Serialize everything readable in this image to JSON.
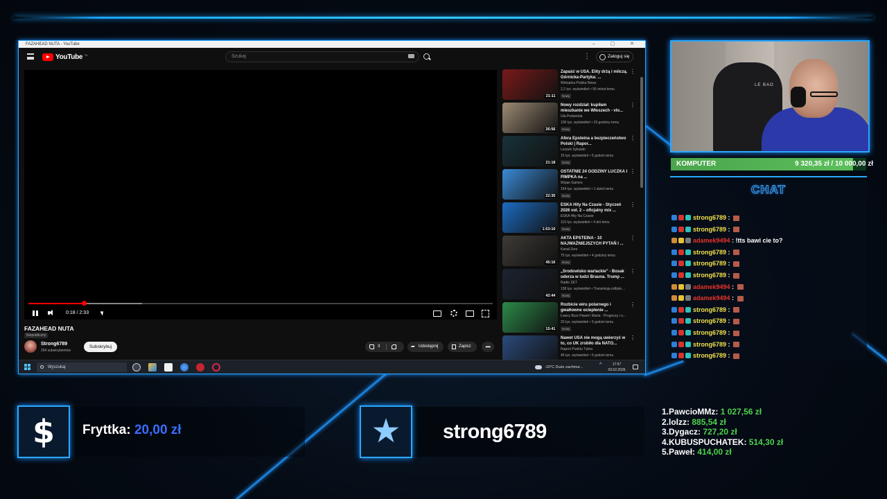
{
  "browser": {
    "window_title": "FAZAHEAD NUTA - YouTube",
    "window_controls": "– ▢ ✕"
  },
  "youtube": {
    "logo_text": "YouTube",
    "logo_sup": "PL",
    "search_placeholder": "Szukaj",
    "login_label": "Zaloguj się",
    "player": {
      "time": "0:18 / 2:33",
      "progress_fraction": 0.12,
      "buffer_fraction": 0.245
    },
    "video": {
      "title": "FAZAHEAD NUTA",
      "visibility": "Niepubliczny",
      "channel": "Strong6789",
      "subscribers": "254 subskrybentów",
      "subscribe_label": "Subskrybuj",
      "likes": "3",
      "share_label": "Udostępnij",
      "save_label": "Zapisz",
      "more_label": "•••"
    },
    "recommendations": [
      {
        "title": "Zapaść w USA. Elity drżą i milczą. Górnicka-Partyka: ...",
        "channel": "Wirtualna Polska News",
        "meta": "2,2 tys. wyświetleń • 56 minut temu",
        "badge": "Nowy",
        "duration": "21:11",
        "color": "#7a1a1a"
      },
      {
        "title": "Nowy rozdział: kupiłam mieszkanie we Włoszech - vlo...",
        "channel": "Ula Pedantula",
        "meta": "106 tys. wyświetleń • 23 godziny temu",
        "badge": "Nowy",
        "duration": "26:56",
        "color": "#9c8a74"
      },
      {
        "title": "Afera Epsteina a bezpieczeństwo Polski | Rapor...",
        "channel": "Leszek Sykulski",
        "meta": "15 tys. wyświetleń • 5 godzin temu",
        "badge": "Nowy",
        "duration": "21:18",
        "color": "#18323a"
      },
      {
        "title": "OSTATNIE 24 GODZINY LUCZKA I PIMPKA na ...",
        "channel": "Wojan Games",
        "meta": "154 tys. wyświetleń • 1 dzień temu",
        "badge": "Nowy",
        "duration": "22:35",
        "color": "#3a8ad6"
      },
      {
        "title": "ESKA Hity Na Czasie - Styczeń 2026 vol. 2 – oficjalny mix ...",
        "channel": "ESKA Hity Na Czasie",
        "meta": "110 tys. wyświetleń • 4 dni temu",
        "badge": "Nowy",
        "duration": "1:53:10",
        "color": "#1c6cc2"
      },
      {
        "title": "AKTA EPSTEINA - 10 NAJWAŻNIEJSZYCH PYTAŃ I ...",
        "channel": "Kanał Zero",
        "meta": "75 tys. wyświetleń • 4 godziny temu",
        "badge": "Nowy",
        "duration": "45:16",
        "color": "#3e3a36"
      },
      {
        "title": "„Środowisko warlackie\" - Bosak uderza w ludzi Brauna. Trump ...",
        "channel": "Radio ZET",
        "meta": "138 tys. wyświetleń • Transmisja odbyła ...",
        "badge": "Nowy",
        "duration": "42:44",
        "color": "#1c2330"
      },
      {
        "title": "Rozbicie wiru polarnego i gwałtowne ocieplenie ...",
        "channel": "Łowcy Burz Paweł i Marta - Prognozy i o...",
        "meta": "20 tys. wyświetleń • 5 godzin temu",
        "badge": "Nowy",
        "duration": "15:41",
        "color": "#2c8a4a"
      },
      {
        "title": "Nawet USA nie mogą uwierzyć w to, co UK zrobiło dla NATO...",
        "channel": "Raport Punktu Tętna",
        "meta": "46 tys. wyświetleń • 6 godzin temu",
        "badge": "Nowy",
        "duration": "17:34",
        "color": "#2a4a7a"
      }
    ]
  },
  "taskbar": {
    "search_placeholder": "Wyszukaj",
    "weather": "-10°C  Duże zachmur...",
    "caret": "^",
    "time": "17:57",
    "date": "03.02.2026"
  },
  "overlay": {
    "goal_label": "KOMPUTER",
    "goal_value": "9 320,35 zł / 10 000,00 zł",
    "goal_fraction": 0.932,
    "chat_title": "CHAT",
    "cam_chair_logo": "LE BAO",
    "chat": [
      {
        "name": "strong6789",
        "text": "",
        "name_color": "#f0e14a",
        "emote": true
      },
      {
        "name": "strong6789",
        "text": "",
        "name_color": "#f0e14a",
        "emote": true
      },
      {
        "name": "adamek9494",
        "text": "!tts bawi cie to?",
        "name_color": "#e8332a",
        "emote": false
      },
      {
        "name": "strong6789",
        "text": "",
        "name_color": "#f0e14a",
        "emote": true
      },
      {
        "name": "strong6789",
        "text": "",
        "name_color": "#f0e14a",
        "emote": true
      },
      {
        "name": "strong6789",
        "text": "",
        "name_color": "#f0e14a",
        "emote": true
      },
      {
        "name": "adamek9494",
        "text": "",
        "name_color": "#e8332a",
        "emote": true
      },
      {
        "name": "adamek9494",
        "text": "",
        "name_color": "#e8332a",
        "emote": true
      },
      {
        "name": "strong6789",
        "text": "",
        "name_color": "#f0e14a",
        "emote": true
      },
      {
        "name": "strong6789",
        "text": "",
        "name_color": "#f0e14a",
        "emote": true
      },
      {
        "name": "strong6789",
        "text": "",
        "name_color": "#f0e14a",
        "emote": true
      },
      {
        "name": "strong6789",
        "text": "",
        "name_color": "#f0e14a",
        "emote": true
      },
      {
        "name": "strong6789",
        "text": "",
        "name_color": "#f0e14a",
        "emote": true
      }
    ],
    "tip_label": "Fryttka:",
    "tip_value": "20,00 zł",
    "follower_name": "strong6789",
    "top_donors": [
      {
        "name": "1.PawcioMMz:",
        "amount": "1 027,56 zł"
      },
      {
        "name": "2.lolzz:",
        "amount": "885,54 zł"
      },
      {
        "name": "3.Dygacz:",
        "amount": "727,20 zł"
      },
      {
        "name": "4.KUBUSPUCHATEK:",
        "amount": "514,30 zł"
      },
      {
        "name": "5.Paweł:",
        "amount": "414,00 zł"
      }
    ],
    "accent_color": "#2aa8ff",
    "amount_color": "#4fd24f",
    "tip_color": "#3a6cff"
  }
}
